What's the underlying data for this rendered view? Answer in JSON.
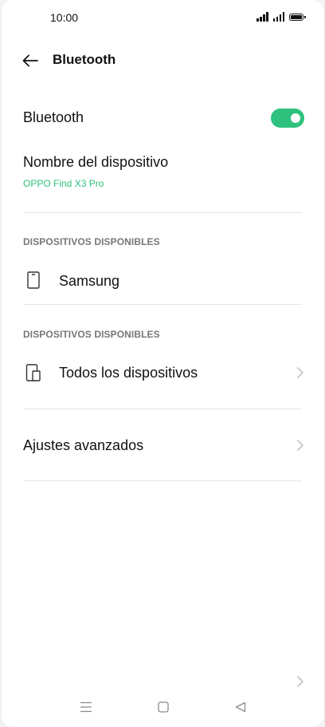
{
  "status": {
    "time": "10:00"
  },
  "header": {
    "title": "Bluetooth"
  },
  "bluetooth_toggle": {
    "label": "Bluetooth",
    "enabled": true,
    "accent_color": "#2ec27e"
  },
  "device_name": {
    "label": "Nombre del dispositivo",
    "value": "OPPO Find X3 Pro"
  },
  "sections": [
    {
      "title": "DISPOSITIVOS DISPONIBLES",
      "items": [
        {
          "label": "Samsung",
          "icon": "phone-icon"
        }
      ]
    },
    {
      "title": "DISPOSITIVOS DISPONIBLES",
      "items": [
        {
          "label": "Todos los dispositivos",
          "icon": "devices-icon"
        }
      ]
    }
  ],
  "advanced": {
    "label": "Ajustes avanzados"
  },
  "nav": {
    "buttons": [
      "menu-icon",
      "home-icon",
      "back-triangle-icon"
    ]
  }
}
